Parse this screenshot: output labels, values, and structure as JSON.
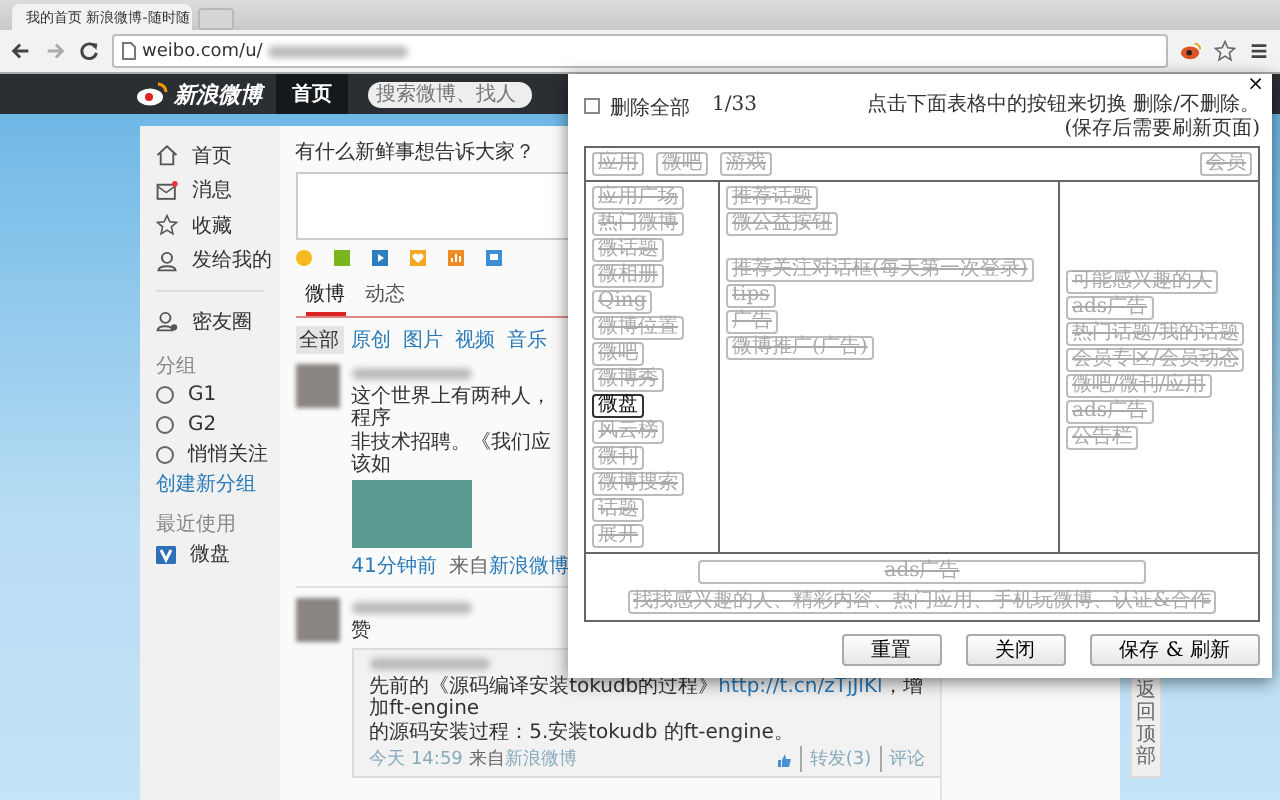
{
  "browser": {
    "tab_title": "我的首页 新浪微博-随时随",
    "address": "weibo.com/u/"
  },
  "nav": {
    "logo": "新浪微博",
    "tabs": [
      {
        "label": "首页",
        "selected": true
      }
    ],
    "search": {
      "placeholder": "搜索微博、找人"
    }
  },
  "sidebar": {
    "items": [
      {
        "kind": "home",
        "label": "首页"
      },
      {
        "kind": "message",
        "label": "消息"
      },
      {
        "kind": "star",
        "label": "收藏"
      },
      {
        "kind": "user",
        "label": "发给我的"
      },
      {
        "kind": "friends",
        "label": "密友圈"
      }
    ],
    "groups_heading": "分组",
    "groups": [
      {
        "label": "G1"
      },
      {
        "label": "G2"
      },
      {
        "label": "悄悄关注"
      }
    ],
    "create_group": "创建新分组",
    "recent_heading": "最近使用",
    "recent": [
      {
        "label": "微盘"
      }
    ]
  },
  "composer": {
    "prompt": "有什么新鲜事想告诉大家？"
  },
  "feed_tabs": [
    {
      "label": "微博",
      "selected": true
    },
    {
      "label": "动态",
      "selected": false
    }
  ],
  "filters": [
    {
      "label": "全部",
      "selected": true
    },
    {
      "label": "原创",
      "selected": false
    },
    {
      "label": "图片",
      "selected": false
    },
    {
      "label": "视频",
      "selected": false
    },
    {
      "label": "音乐",
      "selected": false
    }
  ],
  "posts": [
    {
      "lines": [
        "这个世界上有两种人，程序",
        "非技术招聘。《我们应该如"
      ],
      "time": "41分钟前",
      "source_prefix": "来自",
      "source": "新浪微博"
    },
    {
      "lines": [
        "赞"
      ],
      "quote": {
        "text": "先前的《源码编译安装tokudb的过程》",
        "link": "http://t.cn/zTjJlKl",
        "rest": "，增加ft-engine",
        "line2": "的源码安装过程：5.安装tokudb 的ft-engine。",
        "time": "今天 14:59",
        "source_prefix": "来自",
        "source": "新浪微博",
        "forward": "转发(3)",
        "comment": "评论"
      }
    }
  ],
  "back_to_top": "返回顶部",
  "dialog": {
    "delete_all": {
      "label": "删除全部",
      "checked": false
    },
    "count": "1/33",
    "hint": "点击下面表格中的按钮来切换 删除/不删除。(保存后需要刷新页面)",
    "top_row": [
      {
        "label": "应用",
        "removed": true
      },
      {
        "label": "微吧",
        "removed": true
      },
      {
        "label": "游戏",
        "removed": true
      }
    ],
    "top_right": [
      {
        "label": "会员",
        "removed": true
      }
    ],
    "left_column": [
      {
        "label": "应用广场",
        "removed": true
      },
      {
        "label": "热门微博",
        "removed": true
      },
      {
        "label": "微话题",
        "removed": true
      },
      {
        "label": "微相册",
        "removed": true
      },
      {
        "label": "Qing",
        "removed": true
      },
      {
        "label": "微博位置",
        "removed": true
      },
      {
        "label": "微吧",
        "removed": true
      },
      {
        "label": "微博秀",
        "removed": true
      },
      {
        "label": "微盘",
        "removed": false
      },
      {
        "label": "风云榜",
        "removed": true
      },
      {
        "label": "微刊",
        "removed": true
      },
      {
        "label": "微博搜索",
        "removed": true
      },
      {
        "label": "话题",
        "removed": true
      },
      {
        "label": "展开",
        "removed": true
      }
    ],
    "middle_column": [
      {
        "items": [
          {
            "label": "推荐话题",
            "removed": true
          },
          {
            "label": "微公益按钮",
            "removed": true
          }
        ]
      },
      {
        "items": [
          {
            "label": "推荐关注对话框(每天第一次登录)",
            "removed": true
          },
          {
            "label": "tips",
            "removed": true
          },
          {
            "label": "广告",
            "removed": true
          },
          {
            "label": "微博推广(广告)",
            "removed": true
          }
        ]
      }
    ],
    "right_column": [
      {
        "label": "可能感兴趣的人",
        "removed": true
      },
      {
        "label": "ads广告",
        "removed": true
      },
      {
        "label": "热门话题/我的话题",
        "removed": true
      },
      {
        "label": "会员专区/会员动态",
        "removed": true
      },
      {
        "label": "微吧/微刊/应用",
        "removed": true
      },
      {
        "label": "ads广告",
        "removed": true
      },
      {
        "label": "公告栏",
        "removed": true
      }
    ],
    "bottom_row": [
      {
        "label": "ads广告",
        "removed": true
      },
      {
        "label": "找找感兴趣的人、精彩内容、热门应用、手机玩微博、认证&合作",
        "removed": true
      }
    ],
    "close": "×",
    "buttons": [
      "重置",
      "关闭",
      "保存 & 刷新"
    ]
  }
}
